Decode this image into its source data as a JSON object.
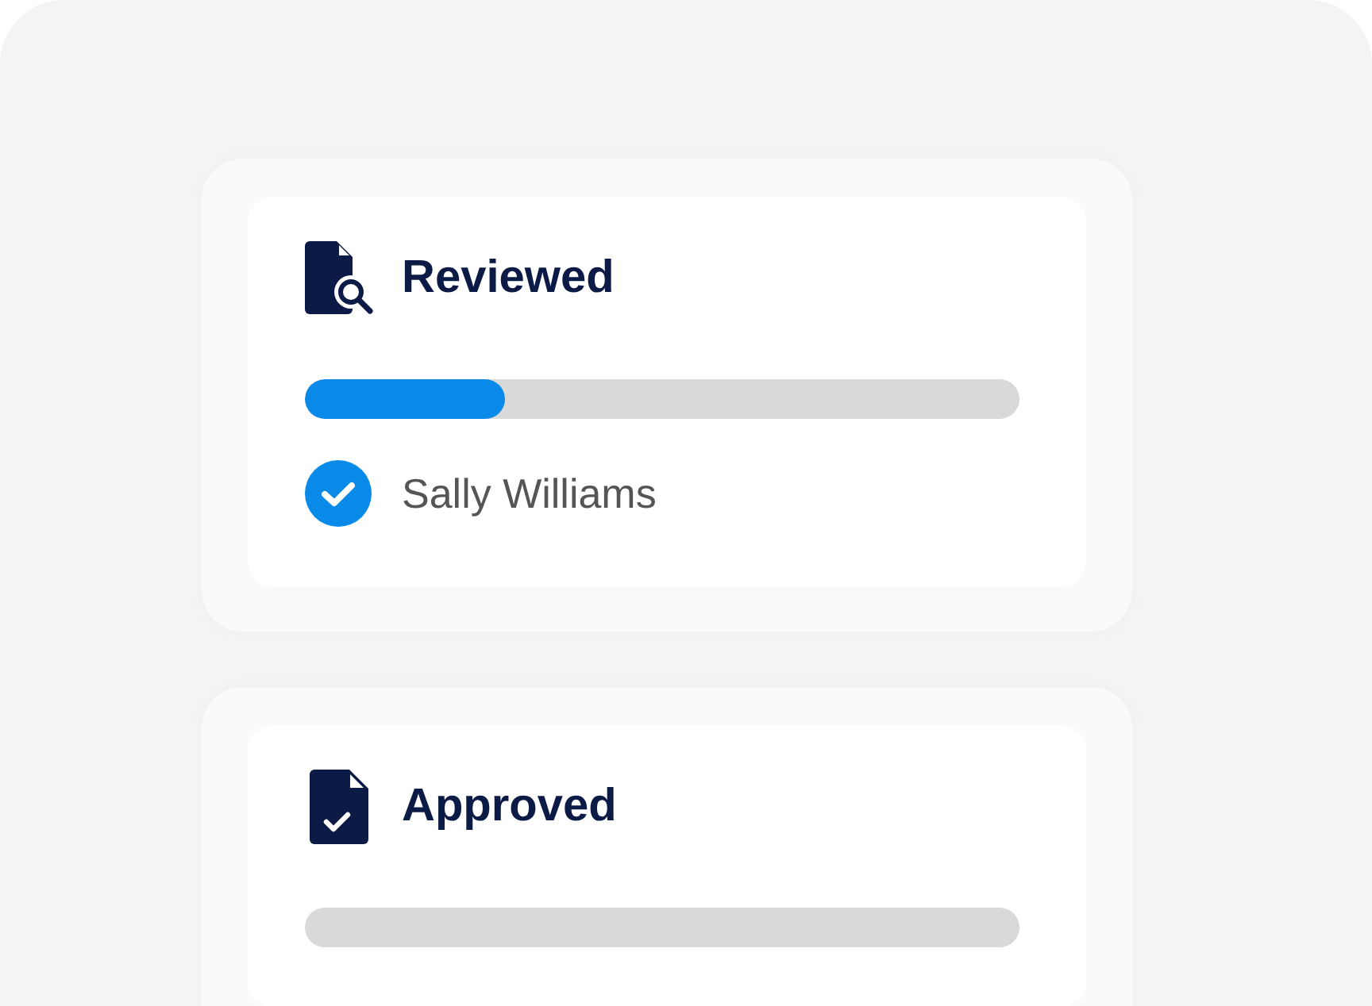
{
  "cards": [
    {
      "kind": "reviewed",
      "title": "Reviewed",
      "progress": {
        "level": 0.28
      },
      "assignees": [
        {
          "name": "Sally Williams",
          "checked": true
        }
      ]
    },
    {
      "kind": "approved",
      "title": "Approved",
      "progress": {
        "level": 0
      }
    }
  ]
}
